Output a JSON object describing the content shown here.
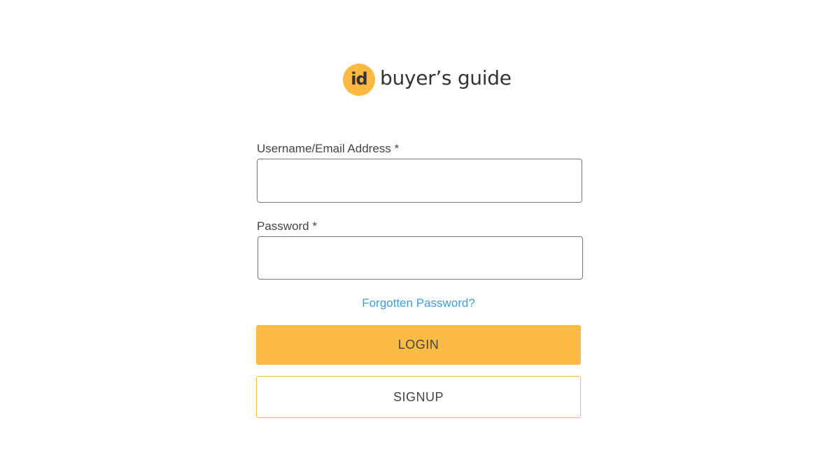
{
  "brand": {
    "badge_text": "id",
    "name": "buyer’s guide",
    "accent_color": "#fbb941"
  },
  "form": {
    "username_label": "Username/Email Address *",
    "username_value": "",
    "password_label": "Password *",
    "password_value": "",
    "forgot_link": "Forgotten Password?",
    "login_label": "LOGIN",
    "signup_label": "SIGNUP"
  },
  "colors": {
    "link": "#3b9ee0",
    "button_primary": "#fcbb44"
  }
}
